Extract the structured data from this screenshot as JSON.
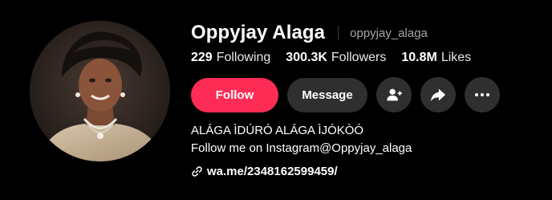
{
  "profile": {
    "display_name": "Oppyjay Alaga",
    "username": "oppyjay_alaga"
  },
  "stats": [
    {
      "value": "229",
      "label": "Following"
    },
    {
      "value": "300.3K",
      "label": "Followers"
    },
    {
      "value": "10.8M",
      "label": "Likes"
    }
  ],
  "actions": {
    "follow_label": "Follow",
    "message_label": "Message"
  },
  "bio": {
    "line1": "ALÁGA ÌDÚRÓ ALÁGA ÌJÓKÒÓ",
    "line2": "Follow me on Instagram@Oppyjay_alaga"
  },
  "link": {
    "text": "wa.me/2348162599459/"
  },
  "icons": {
    "add_friend": "person-plus-icon",
    "share": "share-arrow-icon",
    "more": "more-dots-icon",
    "link": "link-icon"
  },
  "colors": {
    "accent": "#fe2c55",
    "button_bg": "#2f2f2f",
    "background": "#000000",
    "secondary_text": "#a6a6a6"
  }
}
